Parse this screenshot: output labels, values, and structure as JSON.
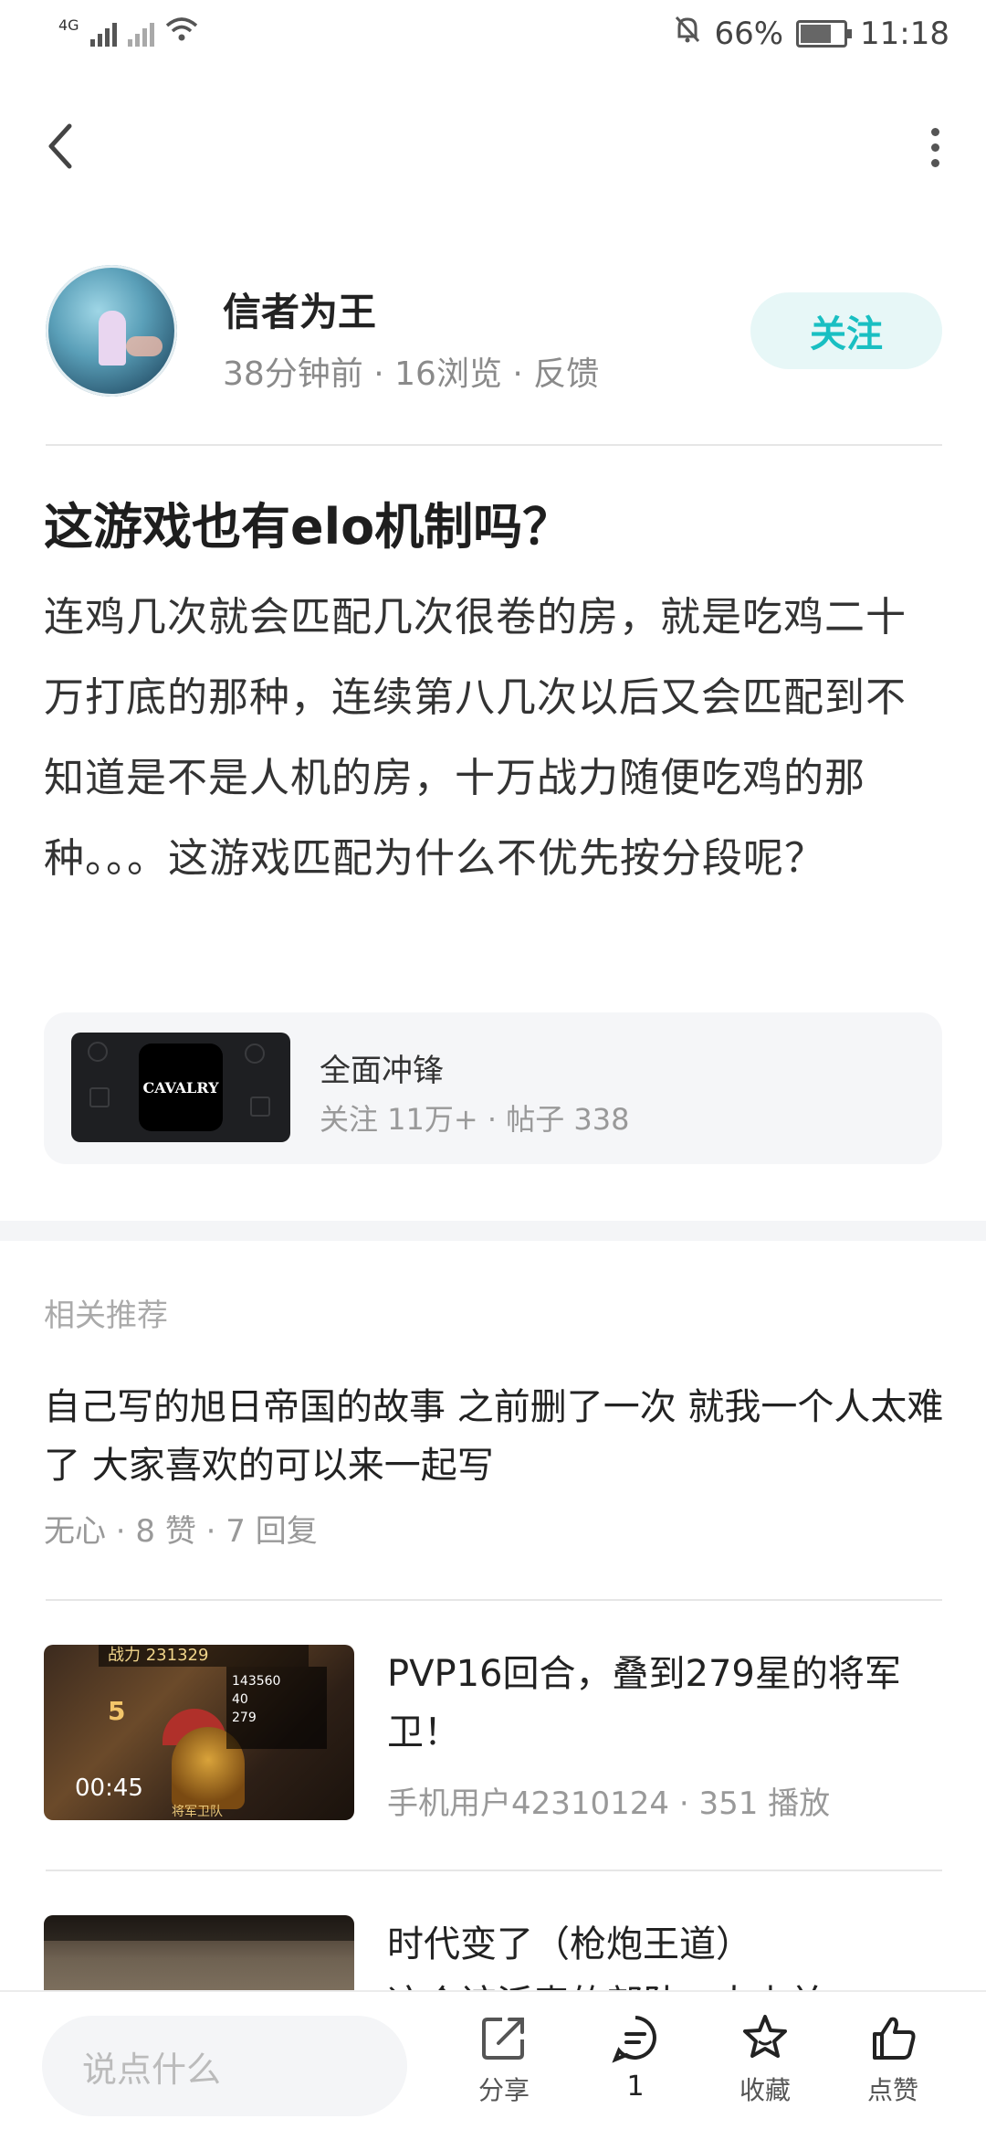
{
  "status_bar": {
    "network_left": "4G",
    "battery_percent": "66%",
    "time": "11:18",
    "battery_level": 0.66
  },
  "nav": {
    "back_icon": "chevron-left-icon",
    "more_icon": "more-vertical-icon"
  },
  "author": {
    "name": "信者为王",
    "meta": "38分钟前 · 16浏览 · 反馈",
    "follow_label": "关注"
  },
  "post": {
    "title": "这游戏也有elo机制吗？",
    "body": "连鸡几次就会匹配几次很卷的房，就是吃鸡二十万打底的那种，连续第八几次以后又会匹配到不知道是不是人机的房，十万战力随便吃鸡的那种。。。这游戏匹配为什么不优先按分段呢？"
  },
  "game_card": {
    "name": "全面冲锋",
    "meta": "关注 11万+ · 帖子 338",
    "logo_text": "CAVALRY"
  },
  "recommendations": {
    "header": "相关推荐",
    "items": [
      {
        "title": "自己写的旭日帝国的故事  之前删了一次  就我一个人太难了  大家喜欢的可以来一起写",
        "meta": "无心 · 8 赞 · 7 回复"
      },
      {
        "title": "PVP16回合，叠到279星的将军卫！",
        "meta": "手机用户42310124 · 351 播放",
        "duration": "00:45",
        "thumb_power": "战力 231329",
        "thumb_stats": [
          "143560",
          "40",
          "279"
        ],
        "thumb_caption": "将军卫队",
        "thumb_level": "5"
      },
      {
        "title": "时代变了（枪炮王道）",
        "subtitle": "这个该派表的部队一大吉并"
      }
    ]
  },
  "bottom_bar": {
    "input_placeholder": "说点什么",
    "share_label": "分享",
    "comment_count": "1",
    "favorite_label": "收藏",
    "like_label": "点赞"
  }
}
